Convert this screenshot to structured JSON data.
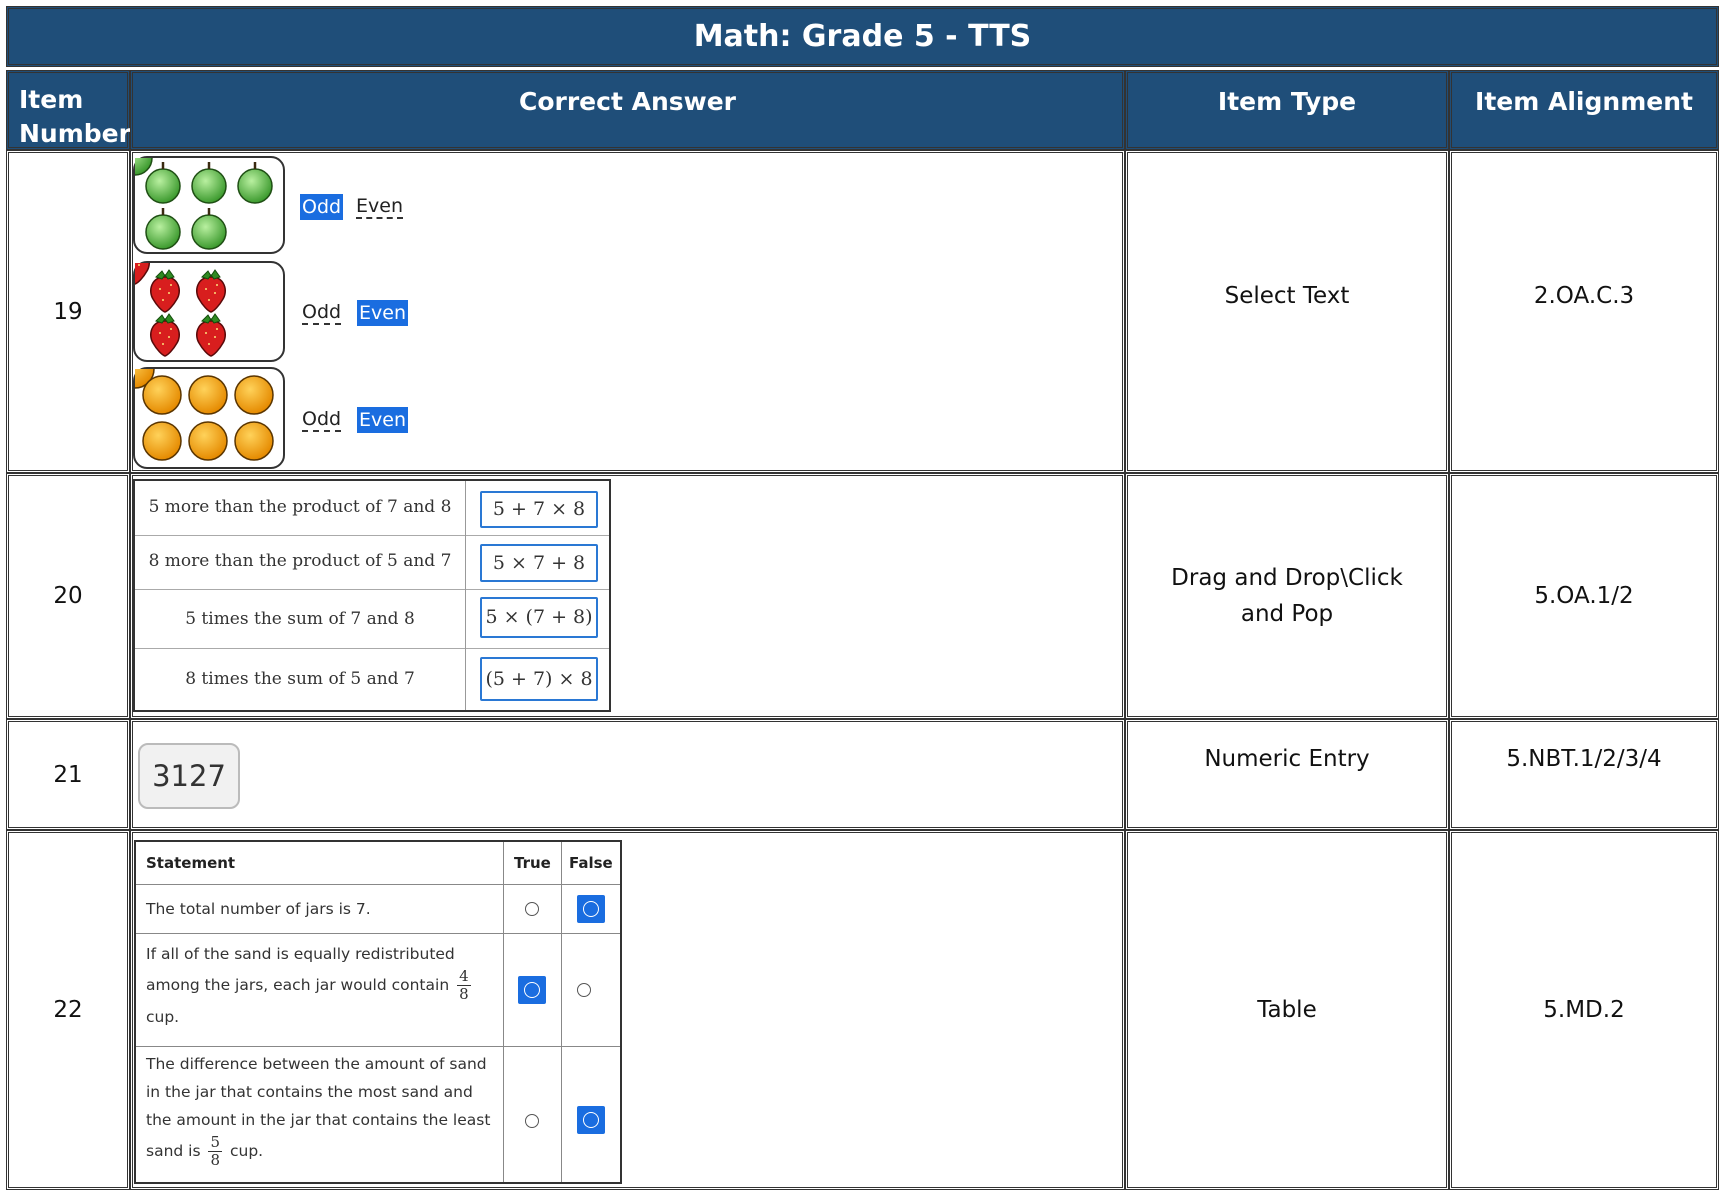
{
  "title": "Math: Grade 5 - TTS",
  "headers": {
    "item_number": "Item Number",
    "item_number_line1": "Item",
    "item_number_line2": "Number",
    "correct_answer": "Correct Answer",
    "item_type": "Item Type",
    "item_alignment": "Item Alignment"
  },
  "rows": [
    {
      "number": "19",
      "item_type": "Select Text",
      "alignment": "2.OA.C.3",
      "answer": {
        "groups": [
          {
            "fruit": "green apples",
            "fruit_icon": "apple-icon",
            "count": 5,
            "options": [
              "Odd",
              "Even"
            ],
            "selected": "Odd"
          },
          {
            "fruit": "strawberries",
            "fruit_icon": "strawberry-icon",
            "count": 4,
            "options": [
              "Odd",
              "Even"
            ],
            "selected": "Even"
          },
          {
            "fruit": "oranges",
            "fruit_icon": "orange-icon",
            "count": 6,
            "options": [
              "Odd",
              "Even"
            ],
            "selected": "Even"
          }
        ]
      }
    },
    {
      "number": "20",
      "item_type": "Drag and Drop\\Click and Pop",
      "alignment": "5.OA.1/2",
      "answer": {
        "pairs": [
          {
            "label": "5 more than the product of 7 and 8",
            "expression": "5 + 7 × 8"
          },
          {
            "label": "8 more than the product of 5 and 7",
            "expression": "5 × 7 + 8"
          },
          {
            "label": "5 times the sum of 7 and 8",
            "expression": "5 × (7 + 8)"
          },
          {
            "label": "8 times the sum of 5 and 7",
            "expression": "(5 + 7) × 8"
          }
        ]
      }
    },
    {
      "number": "21",
      "item_type": "Numeric Entry",
      "alignment": "5.NBT.1/2/3/4",
      "answer": {
        "value": "3127"
      }
    },
    {
      "number": "22",
      "item_type": "Table",
      "alignment": "5.MD.2",
      "answer": {
        "columns": [
          "Statement",
          "True",
          "False"
        ],
        "statements": [
          {
            "text": "The total number of jars is 7.",
            "selected": "False"
          },
          {
            "text_before": "If all of the sand is equally redistributed among the jars, each jar would contain",
            "fraction_num": "4",
            "fraction_den": "8",
            "text_after": "cup.",
            "selected": "True"
          },
          {
            "text_before": "The difference between the amount of sand in the jar that contains the most sand and the amount in the jar that contains the least sand is",
            "fraction_num": "5",
            "fraction_den": "8",
            "text_after": "cup.",
            "selected": "False"
          }
        ]
      }
    }
  ],
  "colors": {
    "header_bg": "#1f4e79",
    "header_text": "#ffffff",
    "selection": "#1a6de0"
  }
}
